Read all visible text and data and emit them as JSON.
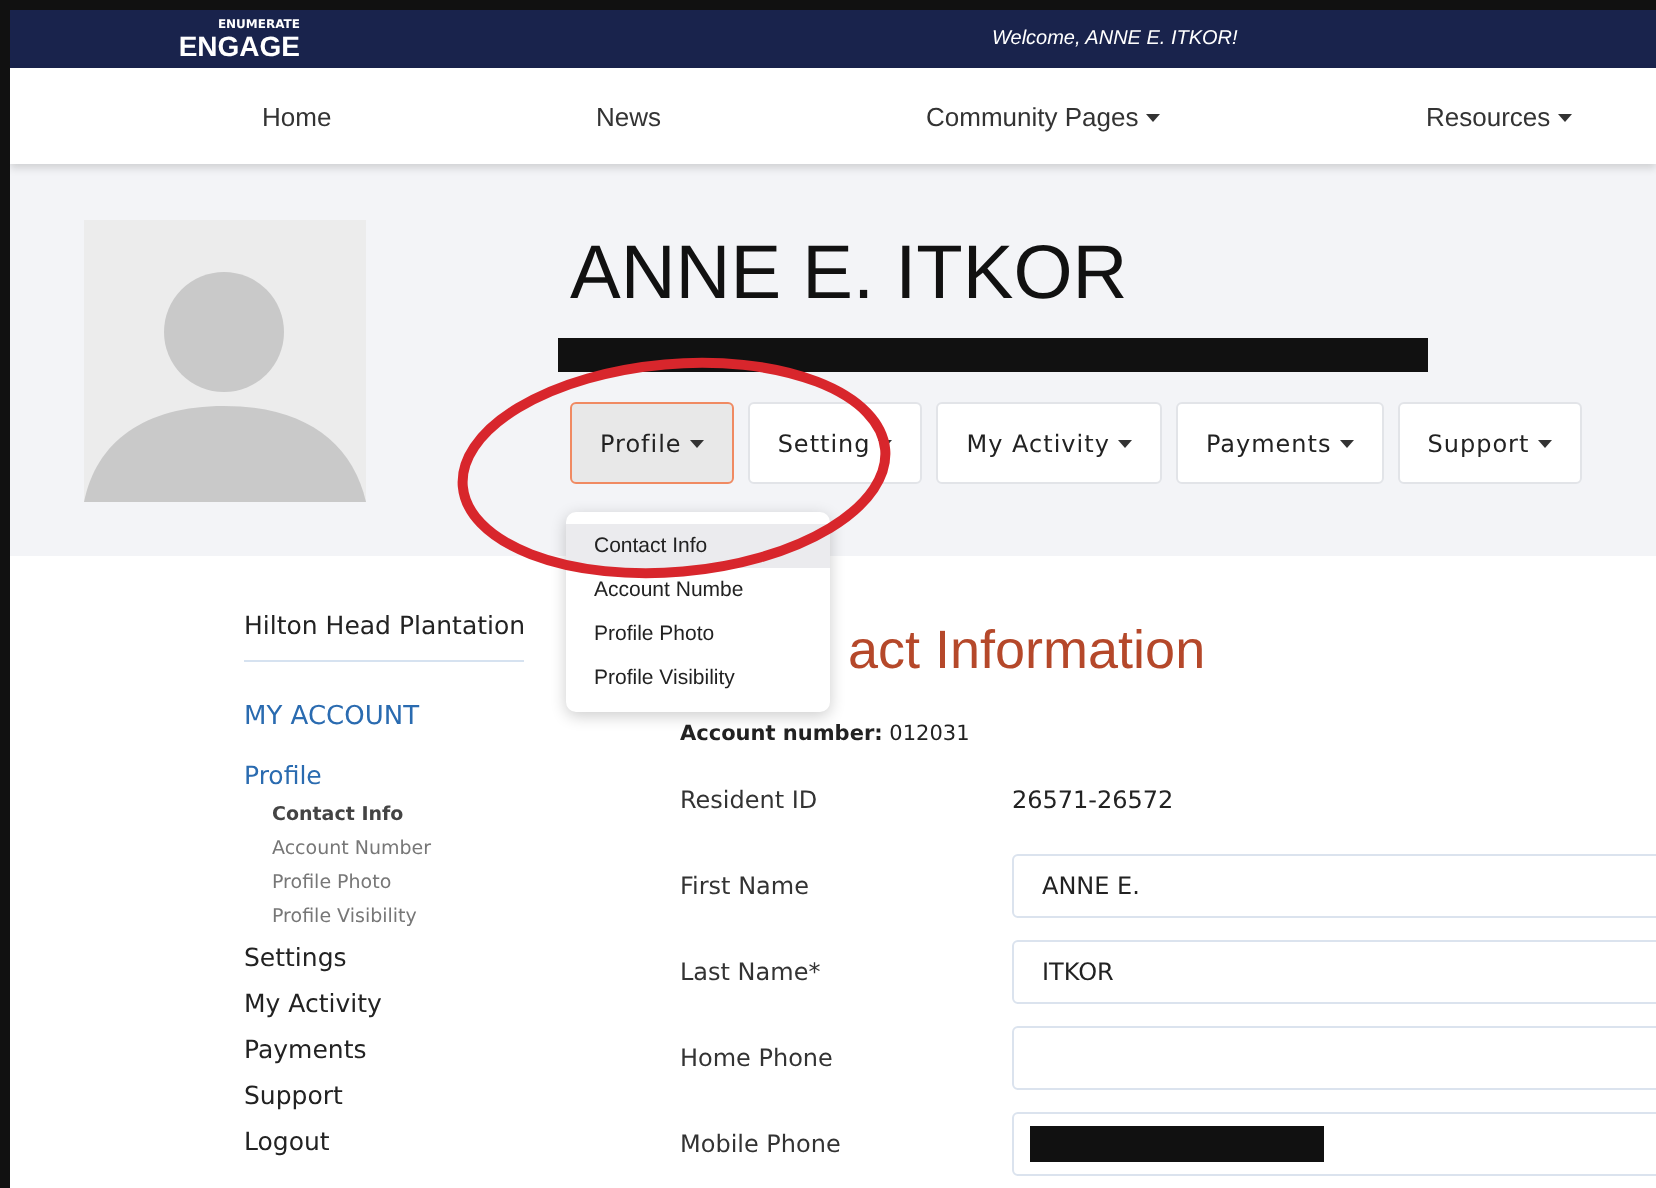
{
  "topbar": {
    "logo_small": "ENUMERATE",
    "logo_big": "ENGAGE",
    "welcome": "Welcome, ANNE E. ITKOR!"
  },
  "nav": [
    {
      "label": "Home",
      "dropdown": false
    },
    {
      "label": "News",
      "dropdown": false
    },
    {
      "label": "Community Pages",
      "dropdown": true
    },
    {
      "label": "Resources",
      "dropdown": true
    }
  ],
  "profile": {
    "name": "ANNE E. ITKOR",
    "subtitle_redacted": true,
    "buttons": [
      {
        "label": "Profile",
        "selected": true
      },
      {
        "label": "Setting",
        "selected": false
      },
      {
        "label": "My Activity",
        "selected": false
      },
      {
        "label": "Payments",
        "selected": false
      },
      {
        "label": "Support",
        "selected": false
      }
    ],
    "dropdown": [
      {
        "label": "Contact Info",
        "selected": true
      },
      {
        "label": "Account Numbe",
        "selected": false
      },
      {
        "label": "Profile Photo",
        "selected": false
      },
      {
        "label": "Profile Visibility",
        "selected": false
      }
    ]
  },
  "sidebar": {
    "community": "Hilton Head Plantation",
    "heading": "MY ACCOUNT",
    "items": [
      {
        "label": "Profile",
        "selected": true,
        "children": [
          {
            "label": "Contact Info",
            "selected": true
          },
          {
            "label": "Account Number",
            "selected": false
          },
          {
            "label": "Profile Photo",
            "selected": false
          },
          {
            "label": "Profile Visibility",
            "selected": false
          }
        ]
      },
      {
        "label": "Settings",
        "selected": false
      },
      {
        "label": "My Activity",
        "selected": false
      },
      {
        "label": "Payments",
        "selected": false
      },
      {
        "label": "Support",
        "selected": false
      },
      {
        "label": "Logout",
        "selected": false
      }
    ]
  },
  "main": {
    "heading": "act Information",
    "account_label": "Account number:",
    "account_value": "012031",
    "fields": [
      {
        "label": "Resident ID",
        "kind": "text",
        "value": "26571-26572"
      },
      {
        "label": "First Name",
        "kind": "input",
        "value": "ANNE E."
      },
      {
        "label": "Last Name*",
        "kind": "input",
        "value": "ITKOR"
      },
      {
        "label": "Home Phone",
        "kind": "input"
      },
      {
        "label": "Mobile Phone",
        "kind": "redacted"
      }
    ]
  },
  "annotation": {
    "kind": "circle",
    "color": "#d8262c"
  }
}
